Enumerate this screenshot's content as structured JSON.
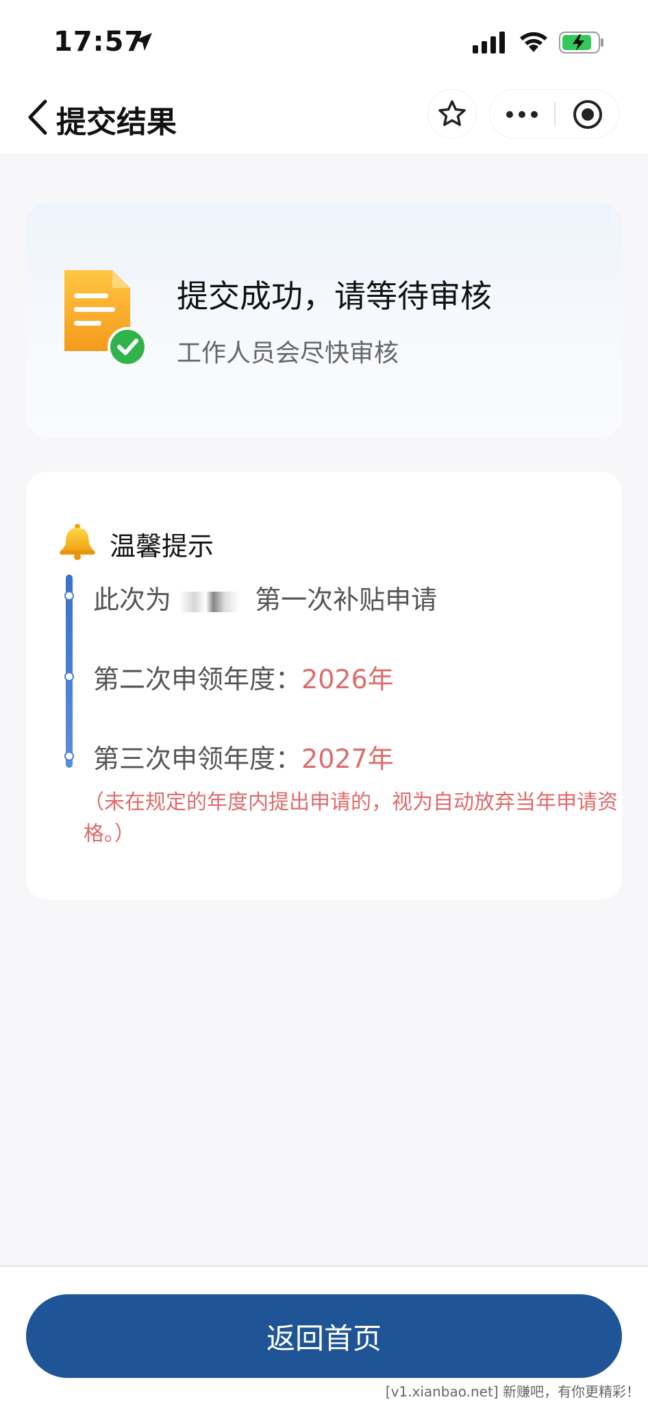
{
  "status_bar": {
    "time": "17:57"
  },
  "nav": {
    "title": "提交结果"
  },
  "result": {
    "title": "提交成功，请等待审核",
    "subtitle": "工作人员会尽快审核"
  },
  "tips": {
    "heading": "温馨提示",
    "line1_prefix": "此次为",
    "line1_suffix": "第一次补贴申请",
    "line2_label": "第二次申领年度：",
    "line2_year": "2026年",
    "line3_label": "第三次申领年度：",
    "line3_year": "2027年",
    "notice": "（未在规定的年度内提出申请的，视为自动放弃当年申请资格。）"
  },
  "footer": {
    "button_label": "返回首页",
    "watermark": "[v1.xianbao.net] 新赚吧，有你更精彩！"
  },
  "colors": {
    "primary": "#1f5597",
    "highlight": "#e06a6a",
    "success": "#2fb34a",
    "document": "#f5a623"
  }
}
